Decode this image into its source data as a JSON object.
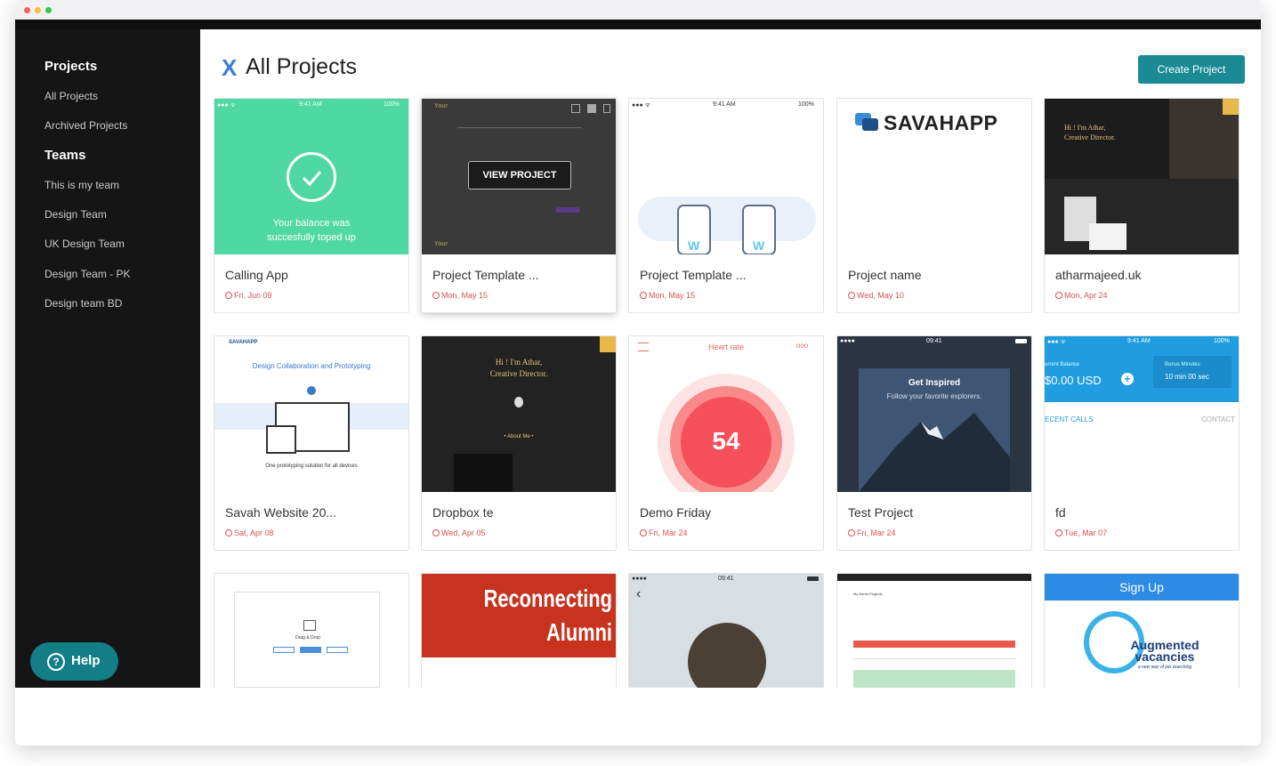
{
  "sidebar": {
    "projects_heading": "Projects",
    "items": [
      "All Projects",
      "Archived Projects"
    ],
    "teams_heading": "Teams",
    "teams": [
      "This is my team",
      "Design Team",
      "UK Design Team",
      "Design Team - PK",
      "Design team BD"
    ],
    "help_label": "Help",
    "help_icon": "question-circle-icon"
  },
  "header": {
    "logo": "X",
    "title": "All Projects",
    "create_button": "Create Project"
  },
  "colors": {
    "accent": "#1a8a94",
    "sidebar_bg": "#151515",
    "date_red": "#d9534f",
    "logo_blue": "#3e7ed6"
  },
  "cards": [
    {
      "name": "Calling App",
      "date": "Fri, Jun 09",
      "thumb": {
        "status_time": "9:41 AM",
        "battery": "100%",
        "message_line1": "Your balance was",
        "message_line2": "succesfully toped up"
      }
    },
    {
      "name": "Project Template ...",
      "date": "Mon, May 15",
      "thumb": {
        "overlay_button": "VIEW PROJECT"
      }
    },
    {
      "name": "Project Template ...",
      "date": "Mon, May 15",
      "thumb": {
        "status_time": "9:41 AM",
        "battery": "100%"
      }
    },
    {
      "name": "Project name",
      "date": "Wed, May 10",
      "thumb": {
        "brand": "SAVAHAPP"
      }
    },
    {
      "name": "atharmajeed.uk",
      "date": "Mon, Apr 24",
      "thumb": {
        "line1": "Hi ! I'm Athar,",
        "line2": "Creative Director."
      }
    },
    {
      "name": "Savah Website 20...",
      "date": "Sat, Apr 08",
      "thumb": {
        "brand": "SAVAHAPP",
        "headline": "Design Collaboration and Prototyping",
        "footer": "One prototyping solution for all devices"
      }
    },
    {
      "name": "Dropbox te",
      "date": "Wed, Apr 05",
      "thumb": {
        "line1": "Hi ! I'm Athar,",
        "line2": "Creative Director.",
        "about": "• About Me •"
      }
    },
    {
      "name": "Demo Friday",
      "date": "Fri, Mar 24",
      "thumb": {
        "title": "Heart rate",
        "value": "54"
      }
    },
    {
      "name": "Test Project",
      "date": "Fri, Mar 24",
      "thumb": {
        "status_time": "09:41",
        "headline": "Get Inspired",
        "sub": "Follow your favorite explorers."
      }
    },
    {
      "name": "fd",
      "date": "Tue, Mar 07",
      "thumb": {
        "status_time": "9:41 AM",
        "battery": "100%",
        "balance_label": "urrent Balance",
        "balance": "$0.00 USD",
        "bonus_label": "Bonus Minutes",
        "bonus": "10 min 00 sec",
        "tab1": "ECENT CALLS",
        "tab2": "CONTACT"
      }
    },
    {
      "name": "",
      "date": "",
      "thumb": {
        "label": "Drag & Drop"
      }
    },
    {
      "name": "",
      "date": "",
      "thumb": {
        "line1": "Reconnecting",
        "line2": "Alumni"
      }
    },
    {
      "name": "",
      "date": "",
      "thumb": {
        "status_time": "09:41"
      }
    },
    {
      "name": "",
      "date": "",
      "thumb": {
        "title": "My Demo Projects"
      }
    },
    {
      "name": "",
      "date": "",
      "thumb": {
        "button": "Sign Up",
        "brand_line1": "Augmented",
        "brand_line2": "vacancies",
        "tagline": "a new way of job searching"
      }
    }
  ]
}
